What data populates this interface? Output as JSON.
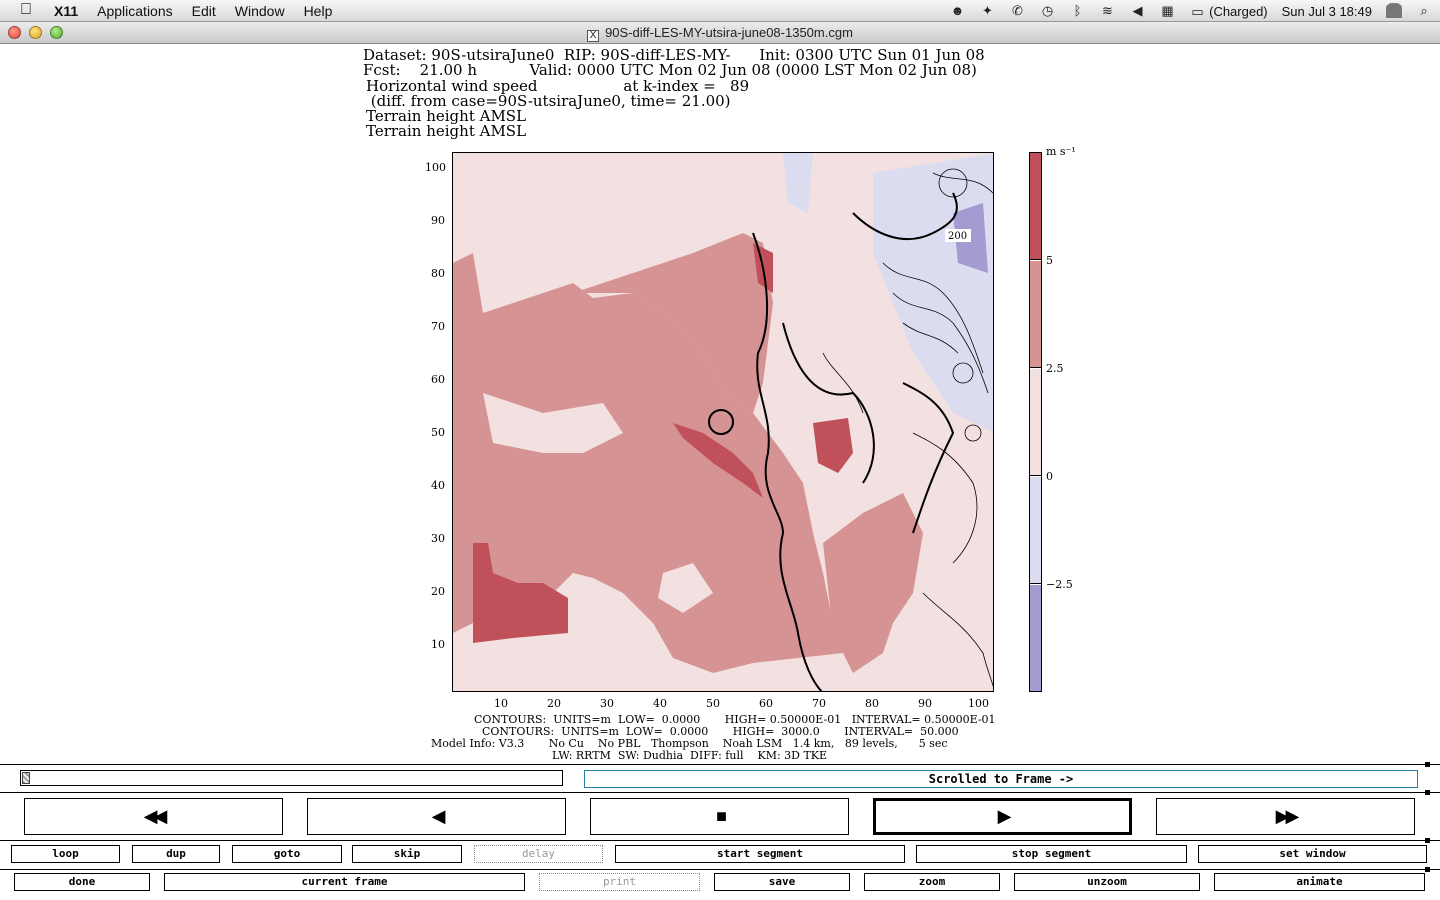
{
  "menubar": {
    "app": "X11",
    "items": [
      "Applications",
      "Edit",
      "Window",
      "Help"
    ],
    "battery": "(Charged)",
    "clock": "Sun Jul 3  18:49"
  },
  "window": {
    "title": "90S-diff-LES-MY-utsira-june08-1350m.cgm"
  },
  "plot": {
    "header": [
      "Dataset: 90S-utsiraJune0  RIP: 90S-diff-LES-MY-      Init: 0300 UTC Sun 01 Jun 08",
      "Fcst:    21.00 h           Valid: 0000 UTC Mon 02 Jun 08 (0000 LST Mon 02 Jun 08)",
      "Horizontal wind speed                  at k-index =   89",
      " (diff. from case=90S-utsiraJune0, time= 21.00)",
      "Terrain height AMSL",
      "Terrain height AMSL"
    ],
    "yticks": [
      "100",
      "90",
      "80",
      "70",
      "60",
      "50",
      "40",
      "30",
      "20",
      "10"
    ],
    "xticks": [
      "10",
      "20",
      "30",
      "40",
      "50",
      "60",
      "70",
      "80",
      "90",
      "100"
    ],
    "contour_label": "200",
    "colorbar_unit": "m s⁻¹",
    "colorbar_ticks": [
      "5",
      "2.5",
      "0",
      "−2.5"
    ],
    "colors": {
      "dark_red": "#c0505a",
      "mid_red": "#d69393",
      "light_pink": "#f3e0e0",
      "light_blue": "#dcdcf0",
      "blue": "#a49cd0"
    },
    "footer": [
      "CONTOURS:  UNITS=m  LOW=  0.0000       HIGH= 0.50000E-01   INTERVAL= 0.50000E-01",
      "CONTOURS:  UNITS=m  LOW=  0.0000       HIGH=  3000.0       INTERVAL=  50.000",
      "Model Info: V3.3       No Cu    No PBL   Thompson    Noah LSM   1.4 km,   89 levels,      5 sec",
      "LW: RRTM  SW: Dudhia  DIFF: full    KM: 3D TKE"
    ]
  },
  "controls": {
    "status": "Scrolled to Frame ->",
    "transport": [
      {
        "name": "rewind-fast-button",
        "glyph": "◀◀",
        "active": false
      },
      {
        "name": "step-back-button",
        "glyph": "◀",
        "active": false
      },
      {
        "name": "stop-button",
        "glyph": "■",
        "active": false
      },
      {
        "name": "play-button",
        "glyph": "▶",
        "active": true
      },
      {
        "name": "forward-fast-button",
        "glyph": "▶▶",
        "active": false
      }
    ],
    "row1": [
      "loop",
      "dup",
      "goto",
      "skip",
      "delay",
      "start segment",
      "stop segment",
      "set window"
    ],
    "row2": [
      "done",
      "current frame",
      "print",
      "save",
      "zoom",
      "unzoom",
      "animate"
    ]
  }
}
